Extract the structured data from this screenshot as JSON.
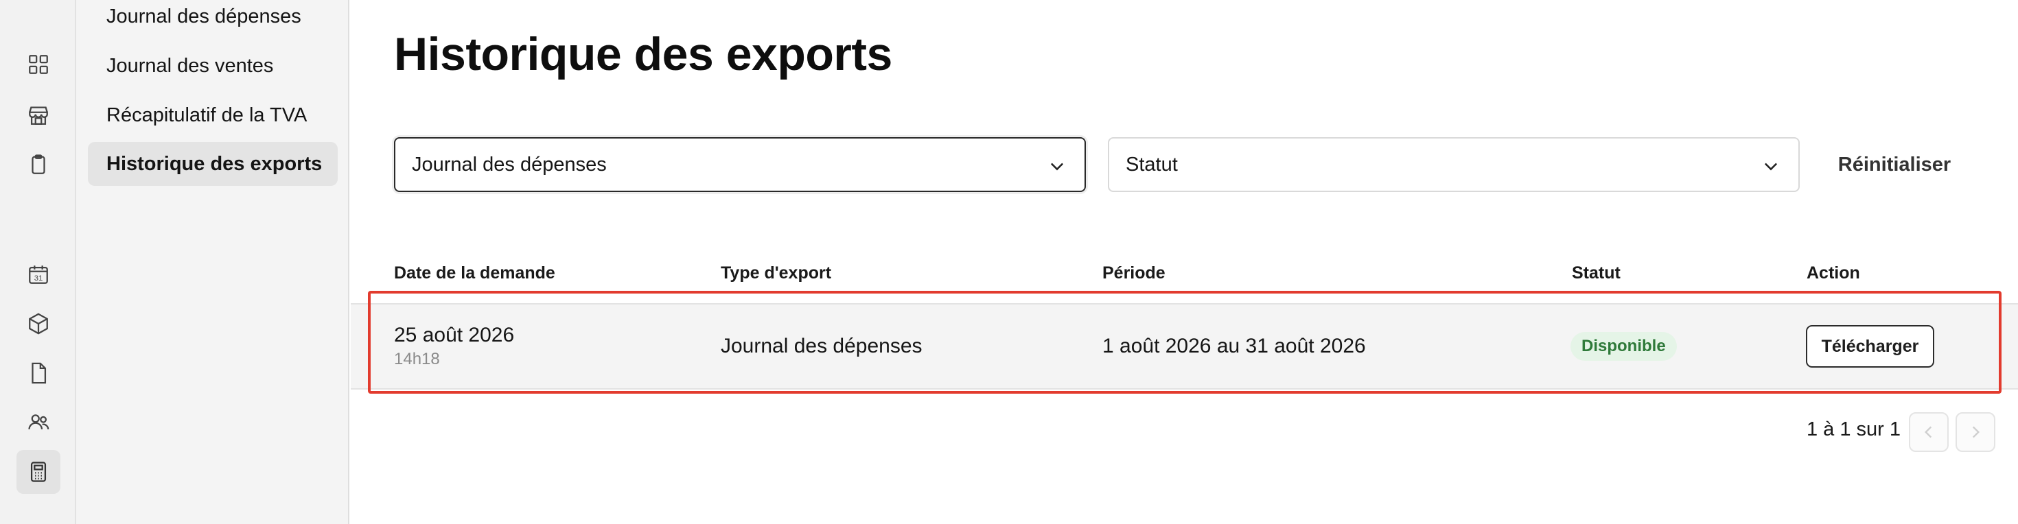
{
  "rail": {
    "icons": [
      "grid-icon",
      "store-icon",
      "clipboard-icon",
      "calendar-icon",
      "box-icon",
      "document-icon",
      "users-icon",
      "calculator-icon"
    ],
    "calendar_day": "31"
  },
  "subnav": {
    "items": [
      {
        "label": "Journal des dépenses"
      },
      {
        "label": "Journal des ventes"
      },
      {
        "label": "Récapitulatif de la TVA"
      },
      {
        "label": "Historique des exports"
      }
    ],
    "active_index": 3
  },
  "page": {
    "title": "Historique des exports"
  },
  "filters": {
    "export_type": {
      "value": "Journal des dépenses"
    },
    "status": {
      "value": "Statut"
    },
    "reset_label": "Réinitialiser"
  },
  "table": {
    "headers": {
      "date": "Date de la demande",
      "type": "Type d'export",
      "period": "Période",
      "status": "Statut",
      "action": "Action"
    },
    "rows": [
      {
        "date": "25 août 2026",
        "time": "14h18",
        "type": "Journal des dépenses",
        "period": "1 août 2026 au 31 août 2026",
        "status": "Disponible",
        "action": "Télécharger"
      }
    ]
  },
  "pagination": {
    "summary": "1 à 1 sur 1"
  },
  "colors": {
    "highlight": "#e23b2e",
    "status_available_bg": "#e5f4e7",
    "status_available_text": "#2f7a3a"
  }
}
